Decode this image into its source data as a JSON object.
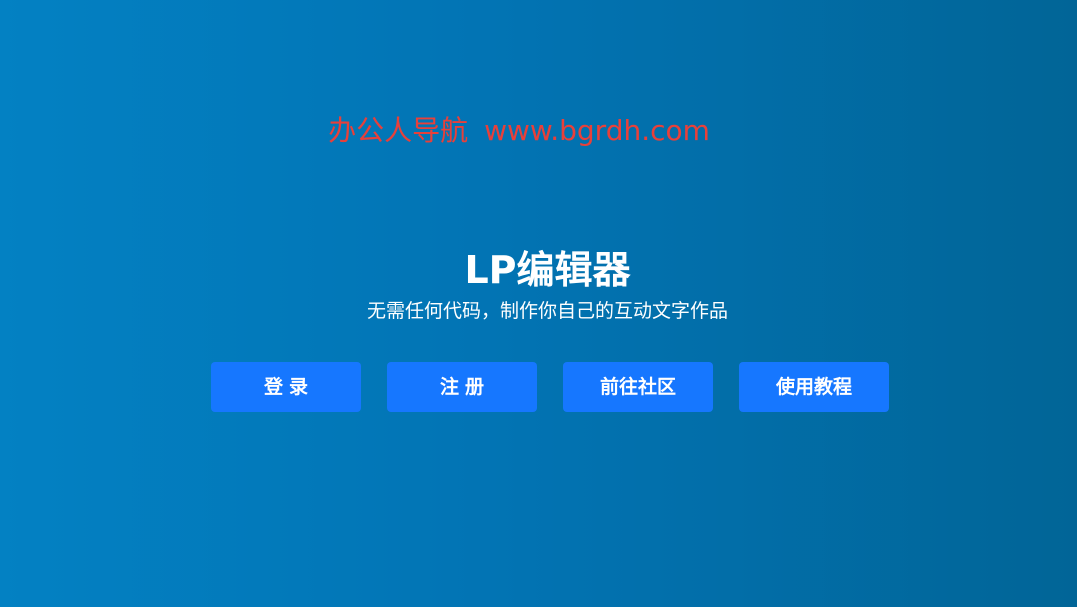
{
  "watermark": {
    "name": "办公人导航",
    "url": "www.bgrdh.com"
  },
  "hero": {
    "title": "LP编辑器",
    "subtitle": "无需任何代码，制作你自己的互动文字作品"
  },
  "actions": {
    "login": "登录",
    "register": "注册",
    "community": "前往社区",
    "tutorial": "使用教程"
  },
  "colors": {
    "background_start": "#0381c3",
    "background_end": "#016597",
    "button": "#1677ff",
    "watermark": "#e8403a",
    "text": "#ffffff"
  }
}
